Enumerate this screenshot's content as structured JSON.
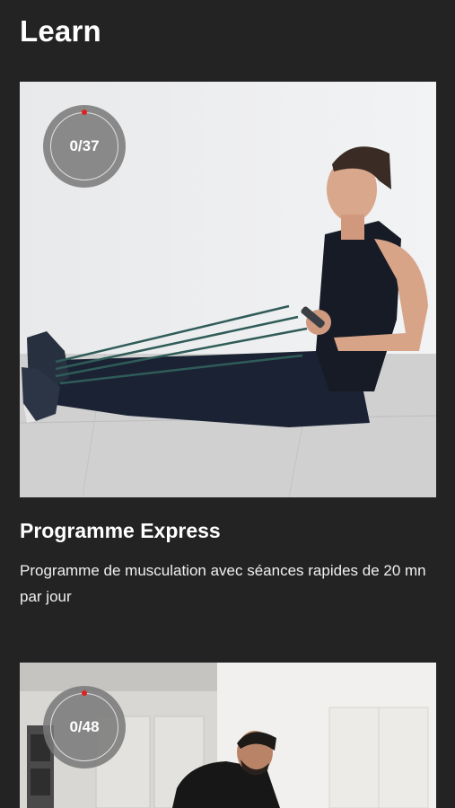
{
  "header": {
    "title": "Learn"
  },
  "programs": [
    {
      "progress_text": "0/37",
      "title": "Programme Express",
      "description": "Programme de musculation avec séances rapides de 20 mn par jour"
    },
    {
      "progress_text": "0/48"
    }
  ],
  "colors": {
    "background": "#232323",
    "progress_dot": "#e02020",
    "badge": "#787878"
  }
}
